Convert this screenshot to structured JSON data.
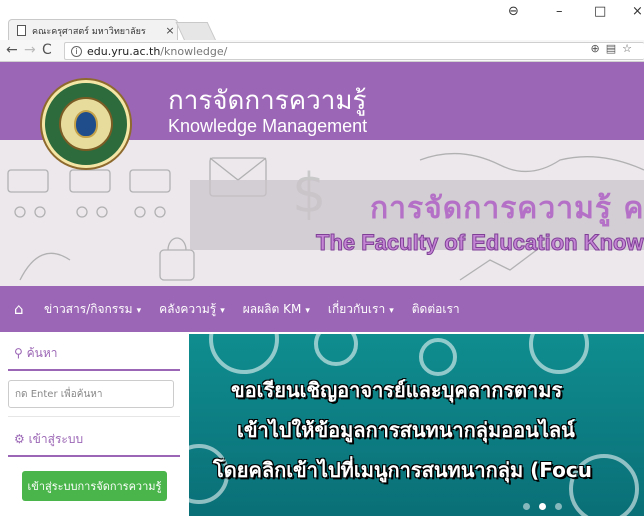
{
  "browser": {
    "tab_title": "คณะครุศาสตร์ มหาวิทยาลัยร",
    "tab_close": "×",
    "url_host": "edu.yru.ac.th",
    "url_path": "/knowledge/",
    "controls": {
      "profile": "⊖",
      "minimize": "–",
      "maximize": "□",
      "close": "×"
    }
  },
  "site": {
    "title_th": "การจัดการความรู้",
    "title_en": "Knowledge Management",
    "banner_th": "การจัดการความรู้ คณ",
    "banner_en": "The Faculty of Education Know"
  },
  "nav": {
    "items": [
      {
        "label": "ข่าวสาร/กิจกรรม",
        "has_caret": true
      },
      {
        "label": "คลังความรู้",
        "has_caret": true
      },
      {
        "label": "ผลผลิต KM",
        "has_caret": true
      },
      {
        "label": "เกี่ยวกับเรา",
        "has_caret": true
      },
      {
        "label": "ติดต่อเรา",
        "has_caret": false
      }
    ],
    "caret": "▾"
  },
  "sidebar": {
    "search_title": "ค้นหา",
    "search_placeholder": "กด Enter เพื่อค้นหา",
    "login_title": "เข้าสู่ระบบ",
    "login_button": "เข้าสู่ระบบการจัดการความรู้"
  },
  "slider": {
    "line1": "ขอเรียนเชิญอาจารย์และบุคลากรตามร",
    "line2": "เข้าไปให้ข้อมูลการสนทนากลุ่มออนไลน์",
    "line3": "โดยคลิกเข้าไปที่เมนูการสนทนากลุ่ม (Focu",
    "active_slide": 1
  },
  "colors": {
    "brand_purple": "#9b66b5",
    "login_green": "#4ab54a",
    "slide_teal": "#0f8d8f"
  }
}
